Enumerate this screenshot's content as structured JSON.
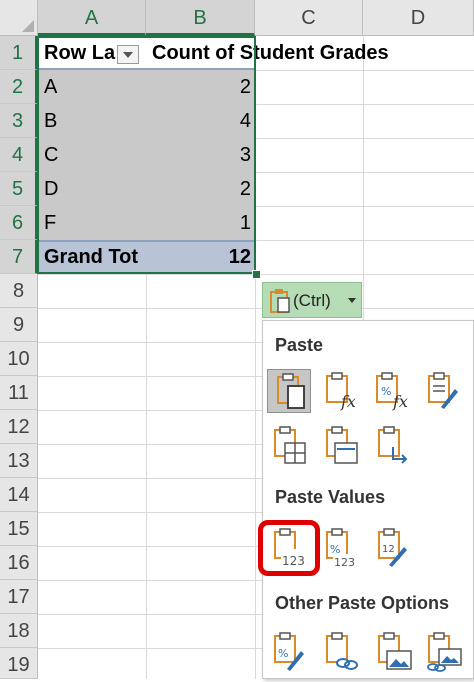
{
  "columns": [
    "A",
    "B",
    "C",
    "D"
  ],
  "rows": [
    "1",
    "2",
    "3",
    "4",
    "5",
    "6",
    "7",
    "8",
    "9",
    "10",
    "11",
    "12",
    "13",
    "14",
    "15",
    "16",
    "17",
    "18",
    "19"
  ],
  "pivot": {
    "header_row_label": "Row La",
    "header_count": "Count of Student Grades",
    "rows": [
      {
        "label": "A",
        "count": "2"
      },
      {
        "label": "B",
        "count": "4"
      },
      {
        "label": "C",
        "count": "3"
      },
      {
        "label": "D",
        "count": "2"
      },
      {
        "label": "F",
        "count": "1"
      }
    ],
    "total_label": "Grand Tot",
    "total_count": "12"
  },
  "paste_button": {
    "label": "(Ctrl)"
  },
  "menu": {
    "paste_title": "Paste",
    "paste_values_title": "Paste Values",
    "other_title": "Other Paste Options",
    "paste_icons": [
      "paste-icon",
      "paste-formulas-icon",
      "paste-formulas-number-formatting-icon",
      "keep-source-formatting-icon",
      "no-borders-icon",
      "keep-column-widths-icon",
      "transpose-icon"
    ],
    "paste_values_icons": [
      "paste-values-icon",
      "values-number-formatting-icon",
      "values-source-formatting-icon"
    ],
    "other_icons": [
      "formatting-icon",
      "paste-link-icon",
      "picture-icon",
      "linked-picture-icon"
    ],
    "number_glyph": "123",
    "percent_glyph": "%",
    "fx_glyph": "fx",
    "twelve_glyph": "12"
  },
  "colors": {
    "excel_green": "#217346",
    "highlight_red": "#e00000",
    "clipboard_orange": "#d98b2b"
  }
}
